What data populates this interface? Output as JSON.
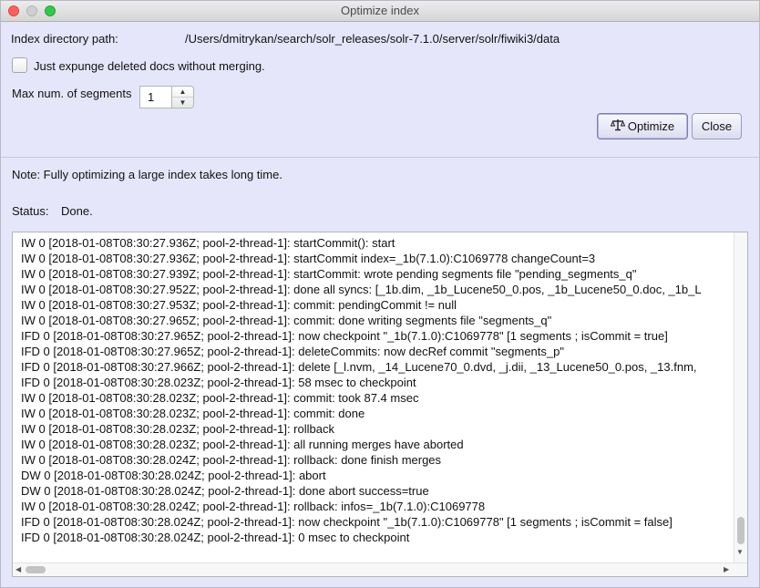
{
  "window": {
    "title": "Optimize index"
  },
  "index": {
    "path_label": "Index directory path:",
    "path_value": "/Users/dmitrykan/search/solr_releases/solr-7.1.0/server/solr/fiwiki3/data"
  },
  "expunge": {
    "label": "Just expunge deleted docs without merging.",
    "checked": false
  },
  "segments": {
    "label": "Max num. of segments",
    "value": "1"
  },
  "buttons": {
    "optimize_label": "Optimize",
    "close_label": "Close"
  },
  "note": "Note: Fully optimizing a large index takes long time.",
  "status": {
    "label": "Status:",
    "value": "Done."
  },
  "log": [
    "IW 0 [2018-01-08T08:30:27.936Z; pool-2-thread-1]: startCommit(): start",
    "IW 0 [2018-01-08T08:30:27.936Z; pool-2-thread-1]: startCommit index=_1b(7.1.0):C1069778 changeCount=3",
    "IW 0 [2018-01-08T08:30:27.939Z; pool-2-thread-1]: startCommit: wrote pending segments file \"pending_segments_q\"",
    "IW 0 [2018-01-08T08:30:27.952Z; pool-2-thread-1]: done all syncs: [_1b.dim, _1b_Lucene50_0.pos, _1b_Lucene50_0.doc, _1b_L",
    "IW 0 [2018-01-08T08:30:27.953Z; pool-2-thread-1]: commit: pendingCommit != null",
    "IW 0 [2018-01-08T08:30:27.965Z; pool-2-thread-1]: commit: done writing segments file \"segments_q\"",
    "IFD 0 [2018-01-08T08:30:27.965Z; pool-2-thread-1]: now checkpoint \"_1b(7.1.0):C1069778\" [1 segments ; isCommit = true]",
    "IFD 0 [2018-01-08T08:30:27.965Z; pool-2-thread-1]: deleteCommits: now decRef commit \"segments_p\"",
    "IFD 0 [2018-01-08T08:30:27.966Z; pool-2-thread-1]: delete [_l.nvm, _14_Lucene70_0.dvd, _j.dii, _13_Lucene50_0.pos, _13.fnm,",
    "IFD 0 [2018-01-08T08:30:28.023Z; pool-2-thread-1]: 58 msec to checkpoint",
    "IW 0 [2018-01-08T08:30:28.023Z; pool-2-thread-1]: commit: took 87.4 msec",
    "IW 0 [2018-01-08T08:30:28.023Z; pool-2-thread-1]: commit: done",
    "IW 0 [2018-01-08T08:30:28.023Z; pool-2-thread-1]: rollback",
    "IW 0 [2018-01-08T08:30:28.023Z; pool-2-thread-1]: all running merges have aborted",
    "IW 0 [2018-01-08T08:30:28.024Z; pool-2-thread-1]: rollback: done finish merges",
    "DW 0 [2018-01-08T08:30:28.024Z; pool-2-thread-1]: abort",
    "DW 0 [2018-01-08T08:30:28.024Z; pool-2-thread-1]: done abort success=true",
    "IW 0 [2018-01-08T08:30:28.024Z; pool-2-thread-1]: rollback: infos=_1b(7.1.0):C1069778",
    "IFD 0 [2018-01-08T08:30:28.024Z; pool-2-thread-1]: now checkpoint \"_1b(7.1.0):C1069778\" [1 segments ; isCommit = false]",
    "IFD 0 [2018-01-08T08:30:28.024Z; pool-2-thread-1]: 0 msec to checkpoint"
  ],
  "icons": {
    "optimize_button_icon": "scale-icon",
    "window_controls": [
      "close-dot-icon",
      "minimize-dot-icon",
      "maximize-dot-icon"
    ]
  },
  "colors": {
    "dialog_background": "#e6e6fa",
    "log_background": "#ffffff",
    "close_dot": "#fc605c",
    "maximize_dot": "#34c84a"
  }
}
